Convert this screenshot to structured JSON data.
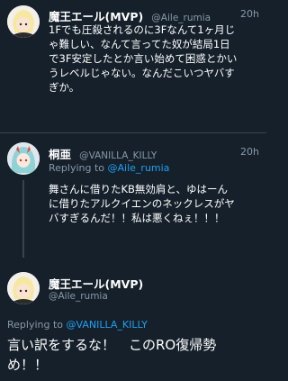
{
  "tweets": [
    {
      "display_name": "魔王エール(MVP)",
      "handle": "@Aile_rumia",
      "time": "20h",
      "lines": [
        "1Fでも圧殺されるのに3Fなんて1ヶ月じ",
        "ゃ難しい、なんて言ってた奴が結局1日",
        "で3F安定したとか言い始めて困惑とかい",
        "うレベルじゃない。なんだこいつヤバす",
        "ぎか。"
      ]
    },
    {
      "display_name": "桐亜",
      "handle": "@VANILLA_KILLY",
      "time": "20h",
      "replying_prefix": "Replying to",
      "replying_to": "@Aile_rumia",
      "lines": [
        "舞さんに借りたKB無効肩と、ゆはーん",
        "に借りたアルクイエンのネックレスがヤ",
        "バすぎるんだ！！私は悪くねぇ！！！"
      ]
    },
    {
      "display_name": "魔王エール(MVP)",
      "handle": "@Aile_rumia",
      "replying_prefix": "Replying to",
      "replying_to": "@VANILLA_KILLY",
      "lines": [
        "言い訳をするな！　このRO復帰勢",
        "め！！"
      ]
    }
  ]
}
